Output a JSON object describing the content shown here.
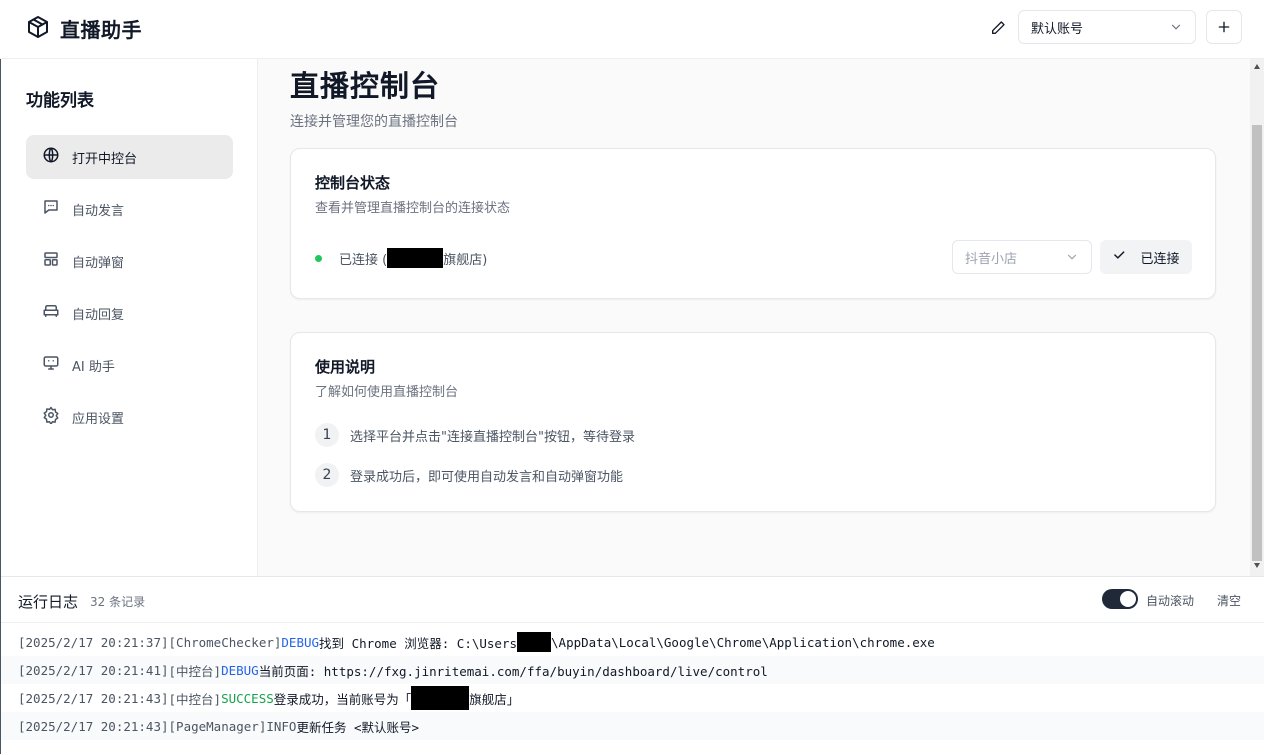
{
  "header": {
    "app_title": "直播助手",
    "account": "默认账号"
  },
  "sidebar": {
    "title": "功能列表",
    "items": [
      {
        "label": "打开中控台",
        "icon": "globe-icon",
        "active": true
      },
      {
        "label": "自动发言",
        "icon": "message-icon",
        "active": false
      },
      {
        "label": "自动弹窗",
        "icon": "layout-icon",
        "active": false
      },
      {
        "label": "自动回复",
        "icon": "sofa-icon",
        "active": false
      },
      {
        "label": "AI 助手",
        "icon": "monitor-icon",
        "active": false
      },
      {
        "label": "应用设置",
        "icon": "gear-icon",
        "active": false
      }
    ]
  },
  "main": {
    "title": "直播控制台",
    "subtitle": "连接并管理您的直播控制台",
    "status_card": {
      "title": "控制台状态",
      "description": "查看并管理直播控制台的连接状态",
      "status_prefix": "已连接 (",
      "status_suffix": "旗舰店)",
      "platform": "抖音小店",
      "connect_label": "已连接"
    },
    "guide_card": {
      "title": "使用说明",
      "description": "了解如何使用直播控制台",
      "steps": [
        {
          "num": "1",
          "text": "选择平台并点击\"连接直播控制台\"按钮，等待登录"
        },
        {
          "num": "2",
          "text": "登录成功后，即可使用自动发言和自动弹窗功能"
        }
      ]
    }
  },
  "logs": {
    "title": "运行日志",
    "count": "32 条记录",
    "autoscroll_label": "自动滚动",
    "autoscroll_on": true,
    "clear_label": "清空",
    "entries": [
      {
        "ts": "[2025/2/17 20:21:37]",
        "src": "[ChromeChecker]",
        "level": "DEBUG",
        "msg_a": "找到 Chrome 浏览器: C:\\Users",
        "msg_b": "\\AppData\\Local\\Google\\Chrome\\Application\\chrome.exe"
      },
      {
        "ts": "[2025/2/17 20:21:41]",
        "src": "[中控台]",
        "level": "DEBUG",
        "msg": "当前页面: https://fxg.jinritemai.com/ffa/buyin/dashboard/live/control"
      },
      {
        "ts": "[2025/2/17 20:21:43]",
        "src": "[中控台]",
        "level": "SUCCESS",
        "msg_a": "登录成功，当前账号为「",
        "msg_b": "旗舰店」"
      },
      {
        "ts": "[2025/2/17 20:21:43]",
        "src": "[PageManager]",
        "level": "INFO",
        "msg": "更新任务 <默认账号>"
      }
    ]
  },
  "colors": {
    "accent": "#1f2937",
    "success_dot": "#22c55e",
    "debug": "#2563eb",
    "success": "#16a34a"
  }
}
